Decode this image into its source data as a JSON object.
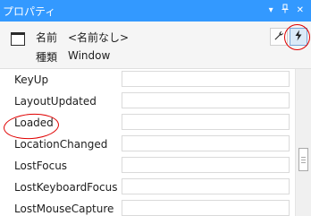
{
  "window": {
    "title": "プロパティ",
    "dropdown_glyph": "▾",
    "pin_glyph": "ᵖ",
    "close_glyph": "✕"
  },
  "header": {
    "name_label": "名前",
    "name_value": "<名前なし>",
    "type_label": "種類",
    "type_value": "Window",
    "properties_button_icon": "wrench-icon",
    "events_button_icon": "lightning-icon"
  },
  "events": [
    {
      "name": "KeyUp",
      "value": ""
    },
    {
      "name": "LayoutUpdated",
      "value": ""
    },
    {
      "name": "Loaded",
      "value": ""
    },
    {
      "name": "LocationChanged",
      "value": ""
    },
    {
      "name": "LostFocus",
      "value": ""
    },
    {
      "name": "LostKeyboardFocus",
      "value": ""
    },
    {
      "name": "LostMouseCapture",
      "value": ""
    }
  ],
  "colors": {
    "titlebar": "#3399ff",
    "annotation": "#e00000"
  }
}
